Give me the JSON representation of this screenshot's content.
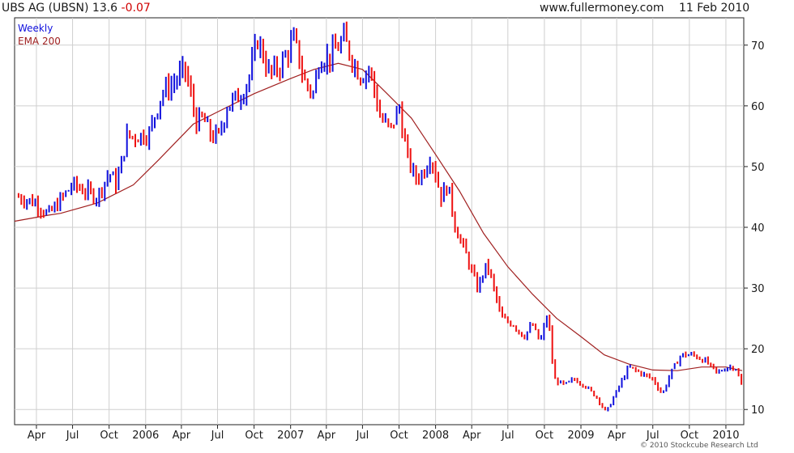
{
  "header": {
    "title": "UBS AG (UBSN) 13.6",
    "change": "-0.07",
    "site": "www.fullermoney.com",
    "date": "11 Feb 2010"
  },
  "copyright": "© 2010 Stockcube Research Ltd",
  "colors": {
    "up": "#1010dd",
    "down": "#ee1111",
    "ema": "#a02020",
    "grid": "#cfcfcf",
    "axis": "#222222"
  },
  "chart_data": {
    "type": "line",
    "legend": [
      "Weekly",
      "EMA 200"
    ],
    "legend_placement": "top-left",
    "y_ticks": [
      10,
      20,
      30,
      40,
      50,
      60,
      70
    ],
    "ylim": [
      7.5,
      74.5
    ],
    "x_labels": [
      {
        "label": "Apr",
        "x": "2005-04-01"
      },
      {
        "label": "Jul",
        "x": "2005-07-01"
      },
      {
        "label": "Oct",
        "x": "2005-10-01"
      },
      {
        "label": "2006",
        "x": "2006-01-01"
      },
      {
        "label": "Apr",
        "x": "2006-04-01"
      },
      {
        "label": "Jul",
        "x": "2006-07-01"
      },
      {
        "label": "Oct",
        "x": "2006-10-01"
      },
      {
        "label": "2007",
        "x": "2007-01-01"
      },
      {
        "label": "Apr",
        "x": "2007-04-01"
      },
      {
        "label": "Jul",
        "x": "2007-07-01"
      },
      {
        "label": "Oct",
        "x": "2007-10-01"
      },
      {
        "label": "2008",
        "x": "2008-01-01"
      },
      {
        "label": "Apr",
        "x": "2008-04-01"
      },
      {
        "label": "Jul",
        "x": "2008-07-01"
      },
      {
        "label": "Oct",
        "x": "2008-10-01"
      },
      {
        "label": "2009",
        "x": "2009-01-01"
      },
      {
        "label": "Apr",
        "x": "2009-04-01"
      },
      {
        "label": "Jul",
        "x": "2009-07-01"
      },
      {
        "label": "Oct",
        "x": "2009-10-01"
      },
      {
        "label": "2010",
        "x": "2010-01-01"
      }
    ],
    "xlim": [
      "2005-02-05",
      "2010-02-15"
    ],
    "grid": true,
    "series": [
      {
        "name": "Weekly",
        "style": "bars",
        "x": [
          "2005-02-15",
          "2005-04-01",
          "2005-05-01",
          "2005-05-20",
          "2005-07-01",
          "2005-09-01",
          "2005-10-01",
          "2005-10-20",
          "2005-11-15",
          "2005-12-15",
          "2006-01-10",
          "2006-02-10",
          "2006-03-15",
          "2006-04-10",
          "2006-05-10",
          "2006-05-25",
          "2006-06-15",
          "2006-07-05",
          "2006-07-25",
          "2006-09-01",
          "2006-09-20",
          "2006-10-10",
          "2006-11-10",
          "2006-12-10",
          "2007-01-10",
          "2007-02-05",
          "2007-02-27",
          "2007-03-15",
          "2007-04-10",
          "2007-05-15",
          "2007-06-10",
          "2007-06-25",
          "2007-07-20",
          "2007-08-15",
          "2007-09-10",
          "2007-10-01",
          "2007-10-20",
          "2007-11-10",
          "2007-12-01",
          "2007-12-20",
          "2008-01-15",
          "2008-02-01",
          "2008-02-20",
          "2008-03-15",
          "2008-04-15",
          "2008-05-10",
          "2008-06-15",
          "2008-07-15",
          "2008-08-10",
          "2008-09-01",
          "2008-09-20",
          "2008-10-10",
          "2008-10-25",
          "2008-11-20",
          "2008-12-15",
          "2009-01-10",
          "2009-02-10",
          "2009-03-05",
          "2009-04-01",
          "2009-05-01",
          "2009-06-01",
          "2009-07-01",
          "2009-07-25",
          "2009-08-15",
          "2009-09-10",
          "2009-10-10",
          "2009-11-10",
          "2009-12-10",
          "2010-01-05",
          "2010-01-25",
          "2010-02-11"
        ],
        "values": [
          45,
          44,
          42,
          43.5,
          47,
          45,
          49,
          47,
          55,
          55,
          55.5,
          62,
          64,
          66,
          57,
          58,
          55,
          55,
          60,
          62,
          65,
          71,
          65,
          67,
          71,
          64,
          62,
          68,
          68,
          71,
          67,
          65,
          66,
          58,
          56,
          60,
          52,
          48,
          49,
          52,
          45,
          47,
          40,
          36,
          30,
          34,
          25,
          24,
          22,
          24,
          21,
          26,
          15,
          14,
          15,
          14,
          12,
          9.5,
          13,
          17,
          16,
          15,
          12.5,
          16,
          19,
          19,
          18,
          16,
          17,
          17,
          13.6
        ]
      },
      {
        "name": "EMA 200",
        "style": "line",
        "x": [
          "2005-02-05",
          "2005-05-01",
          "2005-06-01",
          "2005-09-01",
          "2005-12-01",
          "2006-02-01",
          "2006-05-01",
          "2006-07-01",
          "2006-10-01",
          "2007-01-01",
          "2007-03-01",
          "2007-05-01",
          "2007-07-01",
          "2007-09-01",
          "2007-11-01",
          "2008-01-01",
          "2008-03-01",
          "2008-05-01",
          "2008-07-01",
          "2008-09-01",
          "2008-11-01",
          "2009-01-01",
          "2009-03-01",
          "2009-05-01",
          "2009-07-01",
          "2009-09-01",
          "2009-11-01",
          "2010-01-01",
          "2010-02-11"
        ],
        "values": [
          41,
          42,
          42.3,
          44,
          47,
          51,
          57,
          59,
          62,
          64.5,
          66,
          67,
          66,
          62,
          58,
          52,
          46,
          39,
          33.5,
          29,
          25,
          22,
          19,
          17.5,
          16.5,
          16.4,
          17,
          17,
          16.4
        ]
      }
    ]
  }
}
